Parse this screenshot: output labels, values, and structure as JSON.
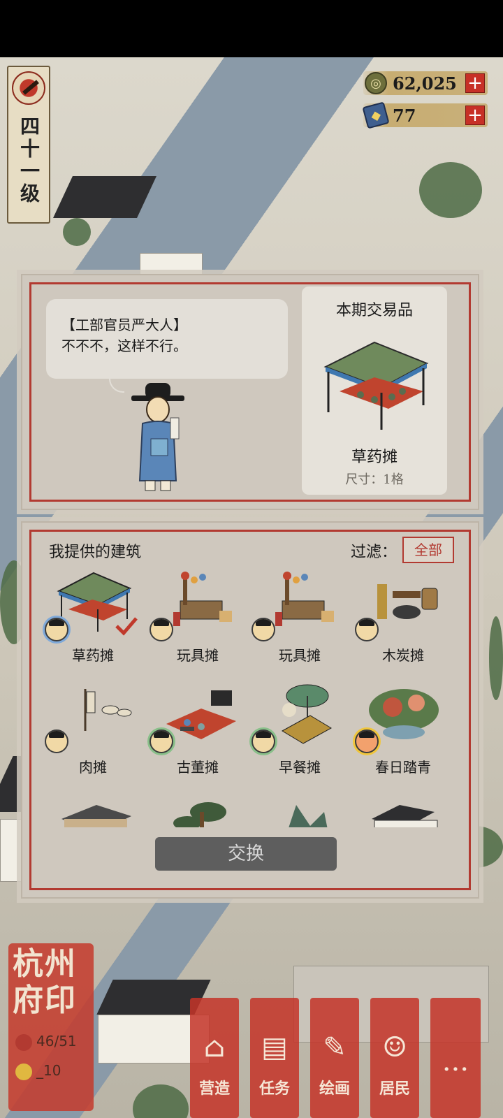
{
  "level": {
    "label": "四十一级"
  },
  "currency": {
    "coins": {
      "value": "62,025",
      "icon": "coin-icon"
    },
    "gems": {
      "value": "77",
      "icon": "gem-icon"
    },
    "plus": "+"
  },
  "dialog": {
    "speaker": "【工部官员严大人】",
    "line": "不不不，这样不行。"
  },
  "trade": {
    "title": "本期交易品",
    "item_name": "草药摊",
    "item_size": "尺寸：1格"
  },
  "offer": {
    "title": "我提供的建筑",
    "filter_label": "过滤：",
    "filter_value": "全部",
    "buildings": [
      {
        "label": "草药摊",
        "selected": true
      },
      {
        "label": "玩具摊",
        "selected": false
      },
      {
        "label": "玩具摊",
        "selected": false
      },
      {
        "label": "木炭摊",
        "selected": false
      },
      {
        "label": "肉摊",
        "selected": false
      },
      {
        "label": "古董摊",
        "selected": false
      },
      {
        "label": "早餐摊",
        "selected": false
      },
      {
        "label": "春日踏青",
        "selected": false
      }
    ],
    "exchange_label": "交换"
  },
  "seal": {
    "title": "杭州府印",
    "stat1": "46/51",
    "stat2": "_10"
  },
  "menu": [
    {
      "label": "营造",
      "icon": "build-icon",
      "glyph": "⌂"
    },
    {
      "label": "任务",
      "icon": "task-icon",
      "glyph": "▤"
    },
    {
      "label": "绘画",
      "icon": "painting-icon",
      "glyph": "✎"
    },
    {
      "label": "居民",
      "icon": "resident-icon",
      "glyph": "☺"
    },
    {
      "label": "",
      "icon": "more-icon",
      "glyph": "···"
    }
  ],
  "colors": {
    "accent_red": "#b23a31",
    "panel": "#cfc8be",
    "card": "#e6e2da"
  }
}
